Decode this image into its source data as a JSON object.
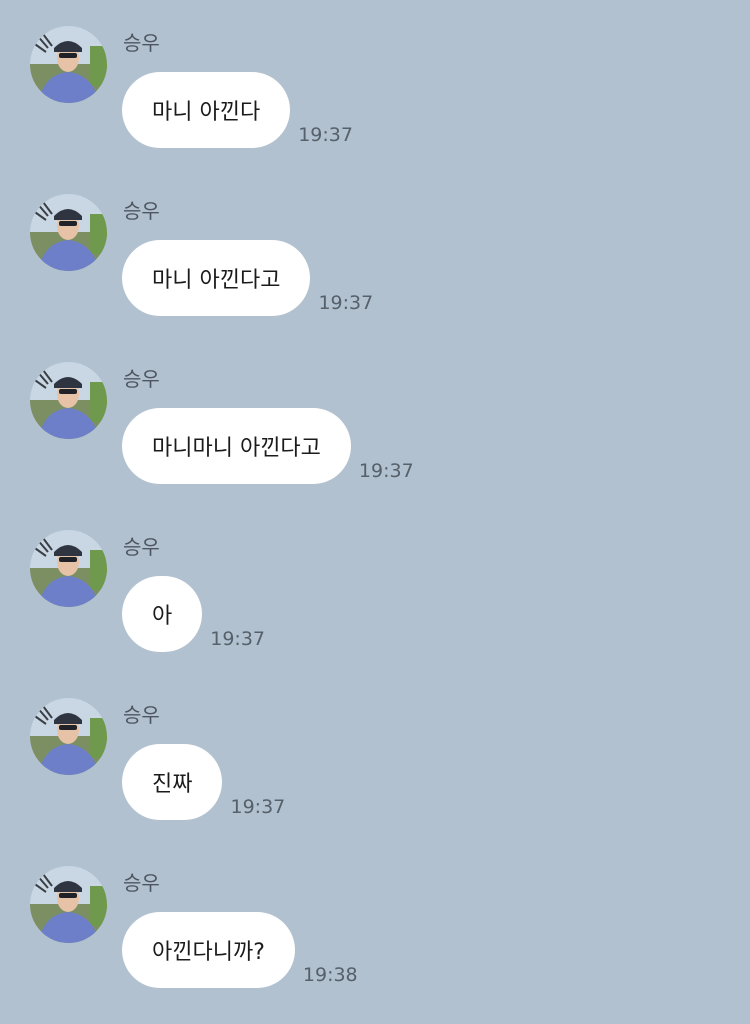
{
  "sender_name": "승우",
  "messages": [
    {
      "text": "마니 아낀다",
      "time": "19:37"
    },
    {
      "text": "마니 아낀다고",
      "time": "19:37"
    },
    {
      "text": "마니마니 아낀다고",
      "time": "19:37"
    },
    {
      "text": "아",
      "time": "19:37"
    },
    {
      "text": "진짜",
      "time": "19:37"
    },
    {
      "text": "아낀다니까?",
      "time": "19:38"
    }
  ],
  "colors": {
    "background": "#b2c1cf",
    "bubble": "#ffffff",
    "time_text": "#56606b"
  },
  "icons": {
    "avatar": "profile-photo"
  }
}
